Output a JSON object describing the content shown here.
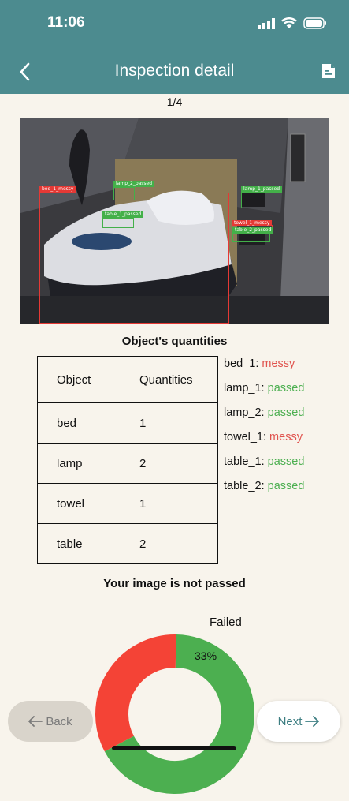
{
  "status_bar": {
    "time": "11:06"
  },
  "header": {
    "title": "Inspection detail"
  },
  "icons": {
    "back": "chevron-left-icon",
    "document": "document-icon"
  },
  "pagination": {
    "text": "1/4"
  },
  "detections": [
    {
      "label": "bed_1_messy",
      "status": "messy"
    },
    {
      "label": "lamp_2_passed",
      "status": "passed"
    },
    {
      "label": "lamp_1_passed",
      "status": "passed"
    },
    {
      "label": "table_1_passed",
      "status": "passed"
    },
    {
      "label": "towel_1_messy",
      "status": "messy"
    },
    {
      "label": "table_2_passed",
      "status": "passed"
    }
  ],
  "quantities": {
    "title": "Object's quantities",
    "headers": [
      "Object",
      "Quantities"
    ],
    "rows": [
      [
        "bed",
        "1"
      ],
      [
        "lamp",
        "2"
      ],
      [
        "towel",
        "1"
      ],
      [
        "table",
        "2"
      ]
    ]
  },
  "object_status": [
    {
      "name": "bed_1:",
      "status": "messy"
    },
    {
      "name": "lamp_1:",
      "status": "passed"
    },
    {
      "name": "lamp_2:",
      "status": "passed"
    },
    {
      "name": "towel_1:",
      "status": "messy"
    },
    {
      "name": "table_1:",
      "status": "passed"
    },
    {
      "name": "table_2:",
      "status": "passed"
    }
  ],
  "result": {
    "message": "Your image is not passed"
  },
  "chart_data": {
    "type": "pie",
    "labels": [
      "Failed",
      ""
    ],
    "values": [
      33,
      67
    ],
    "data_labels": [
      "33%",
      ""
    ],
    "colors": [
      "#f44336",
      "#4caf50"
    ]
  },
  "buttons": {
    "back": "Back",
    "next": "Next"
  },
  "colors": {
    "header": "#4c8b8f",
    "messy": "#e0524d",
    "passed": "#4caf50",
    "background": "#f8f4ec"
  }
}
